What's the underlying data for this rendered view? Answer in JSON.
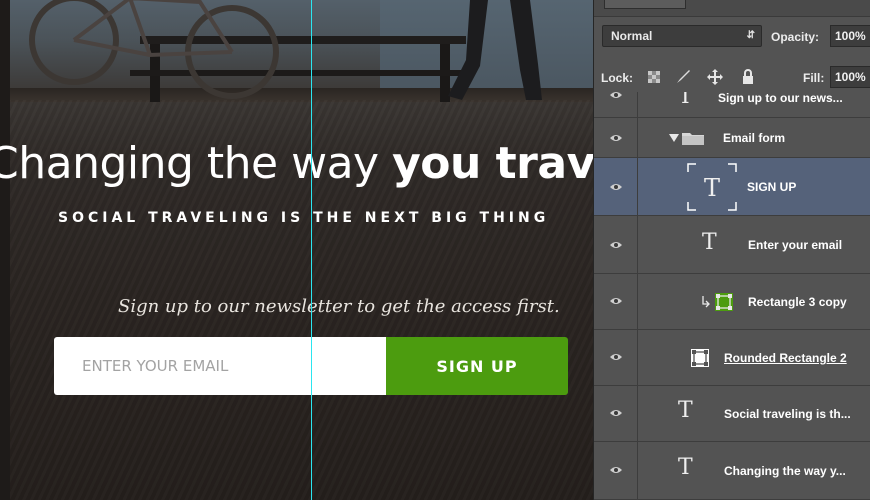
{
  "canvas": {
    "headline_regular": "Changing the way ",
    "headline_bold": "you trave",
    "tagline": "SOCIAL TRAVELING IS THE NEXT BIG THING",
    "subtext": "Sign up to our newsletter to get the access first.",
    "email_placeholder": "ENTER YOUR EMAIL",
    "signup_label": "SIGN UP",
    "accent_color": "#4c9c0f",
    "guide_color": "#2be6f0"
  },
  "layers_panel": {
    "blend_mode": "Normal",
    "opacity_label": "Opacity:",
    "opacity_value": "100%",
    "lock_label": "Lock:",
    "fill_label": "Fill:",
    "fill_value": "100%",
    "lock_icons": [
      "lock-transparent-pixels-icon",
      "lock-image-pixels-icon",
      "lock-position-icon",
      "lock-all-icon"
    ],
    "layers": [
      {
        "name": "Sign up to our news...",
        "kind": "text",
        "icon": "text-layer-icon"
      },
      {
        "name": "Email form",
        "kind": "group",
        "icon": "folder-icon",
        "expanded": true
      },
      {
        "name": "SIGN UP",
        "kind": "text",
        "icon": "text-layer-icon",
        "selected": true
      },
      {
        "name": "Enter your email",
        "kind": "text",
        "icon": "text-layer-icon"
      },
      {
        "name": "Rectangle 3 copy",
        "kind": "shape",
        "icon": "shape-layer-icon",
        "clipped": true
      },
      {
        "name": "Rounded Rectangle 2",
        "kind": "shape",
        "icon": "shape-layer-icon"
      },
      {
        "name": "Social traveling is th...",
        "kind": "text",
        "icon": "text-layer-icon"
      },
      {
        "name": "Changing the way y...",
        "kind": "text",
        "icon": "text-layer-icon"
      }
    ]
  }
}
